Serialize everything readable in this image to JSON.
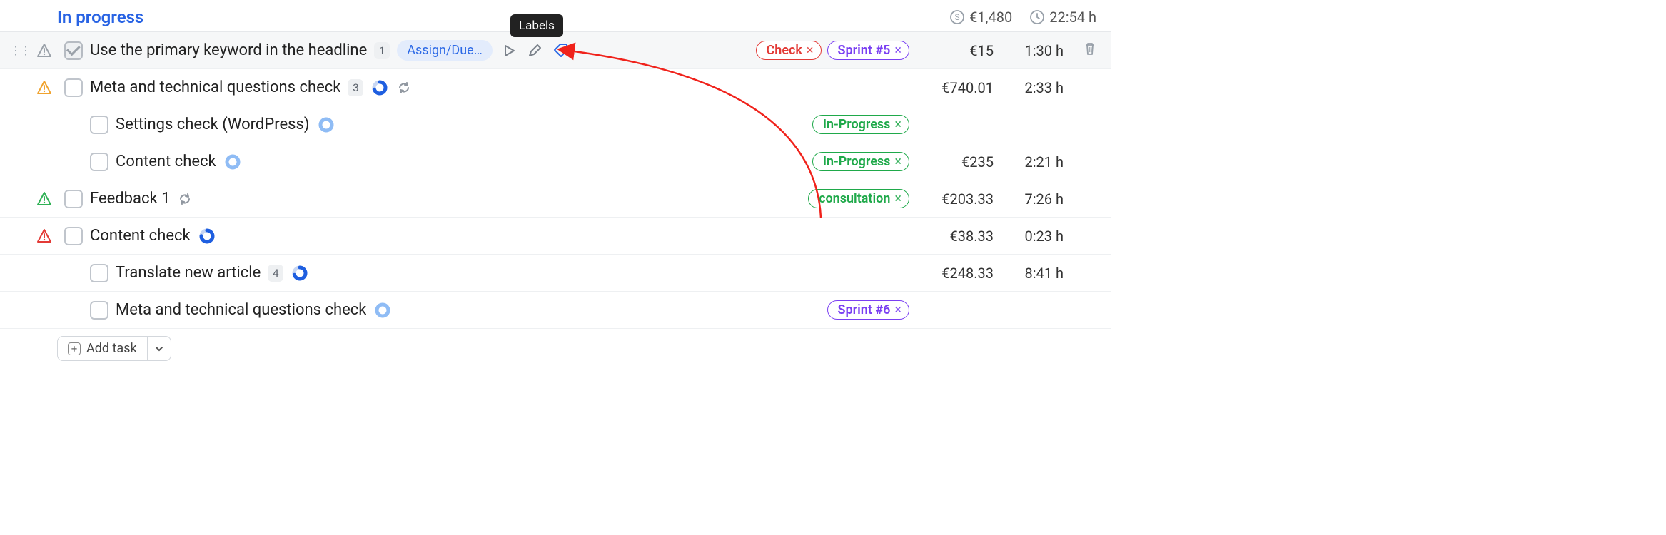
{
  "tooltip": {
    "label": "Labels"
  },
  "section": {
    "title": "In progress",
    "total_cost": "€1,480",
    "total_hours": "22:54 h"
  },
  "assign_btn": "Assign/Due…",
  "addtask_label": "Add task",
  "tasks": [
    {
      "indent": 1,
      "highlight": true,
      "drag": true,
      "priority": {
        "icon": "warn",
        "color": "#9aa1a9"
      },
      "checked": true,
      "title": "Use the primary keyword in the headline",
      "count": "1",
      "show_assign": true,
      "show_play": true,
      "show_edit": true,
      "show_tag": true,
      "ring": null,
      "refresh": false,
      "tags": [
        {
          "label": "Check",
          "class": "chip-red"
        },
        {
          "label": "Sprint #5",
          "class": "chip-purple"
        }
      ],
      "cost": "€15",
      "hours": "1:30 h",
      "trash": true
    },
    {
      "indent": 1,
      "highlight": false,
      "drag": false,
      "priority": {
        "icon": "warn",
        "color": "#f0a32f"
      },
      "checked": false,
      "title": "Meta and technical questions check",
      "count": "3",
      "ring": {
        "color": "#1f5fe0",
        "track": "#c7d6f3",
        "frac": 0.7
      },
      "refresh": true,
      "tags": [],
      "cost": "€740.01",
      "hours": "2:33 h"
    },
    {
      "indent": 2,
      "highlight": false,
      "drag": false,
      "priority": null,
      "checked": false,
      "title": "Settings check (WordPress)",
      "count": null,
      "ring": {
        "color": "#8fbcf5",
        "track": "#e3ecfb",
        "frac": 0.99
      },
      "refresh": false,
      "tags": [
        {
          "label": "In-Progress",
          "class": "chip-green"
        }
      ],
      "cost": "",
      "hours": ""
    },
    {
      "indent": 2,
      "highlight": false,
      "drag": false,
      "priority": null,
      "checked": false,
      "title": "Content check",
      "count": null,
      "ring": {
        "color": "#8fbcf5",
        "track": "#e3ecfb",
        "frac": 0.99
      },
      "refresh": false,
      "tags": [
        {
          "label": "In-Progress",
          "class": "chip-green"
        }
      ],
      "cost": "€235",
      "hours": "2:21 h"
    },
    {
      "indent": 1,
      "highlight": false,
      "drag": false,
      "priority": {
        "icon": "warn",
        "color": "#2fb155"
      },
      "checked": false,
      "title": "Feedback 1",
      "count": null,
      "ring": null,
      "refresh": true,
      "tags": [
        {
          "label": "consultation",
          "class": "chip-green"
        }
      ],
      "cost": "€203.33",
      "hours": "7:26 h"
    },
    {
      "indent": 1,
      "highlight": false,
      "drag": false,
      "priority": {
        "icon": "warn",
        "color": "#e33a36"
      },
      "checked": false,
      "title": "Content check",
      "count": null,
      "ring": {
        "color": "#1f5fe0",
        "track": "#c7d6f3",
        "frac": 0.75
      },
      "refresh": false,
      "tags": [],
      "cost": "€38.33",
      "hours": "0:23 h"
    },
    {
      "indent": 2,
      "highlight": false,
      "drag": false,
      "priority": null,
      "checked": false,
      "title": "Translate new article",
      "count": "4",
      "ring": {
        "color": "#1f5fe0",
        "track": "#c7d6f3",
        "frac": 0.7
      },
      "refresh": false,
      "tags": [],
      "cost": "€248.33",
      "hours": "8:41 h"
    },
    {
      "indent": 2,
      "highlight": false,
      "drag": false,
      "priority": null,
      "checked": false,
      "title": "Meta and technical questions check",
      "count": null,
      "ring": {
        "color": "#8fbcf5",
        "track": "#e3ecfb",
        "frac": 0.99
      },
      "refresh": false,
      "tags": [
        {
          "label": "Sprint #6",
          "class": "chip-purple"
        }
      ],
      "cost": "",
      "hours": ""
    }
  ]
}
